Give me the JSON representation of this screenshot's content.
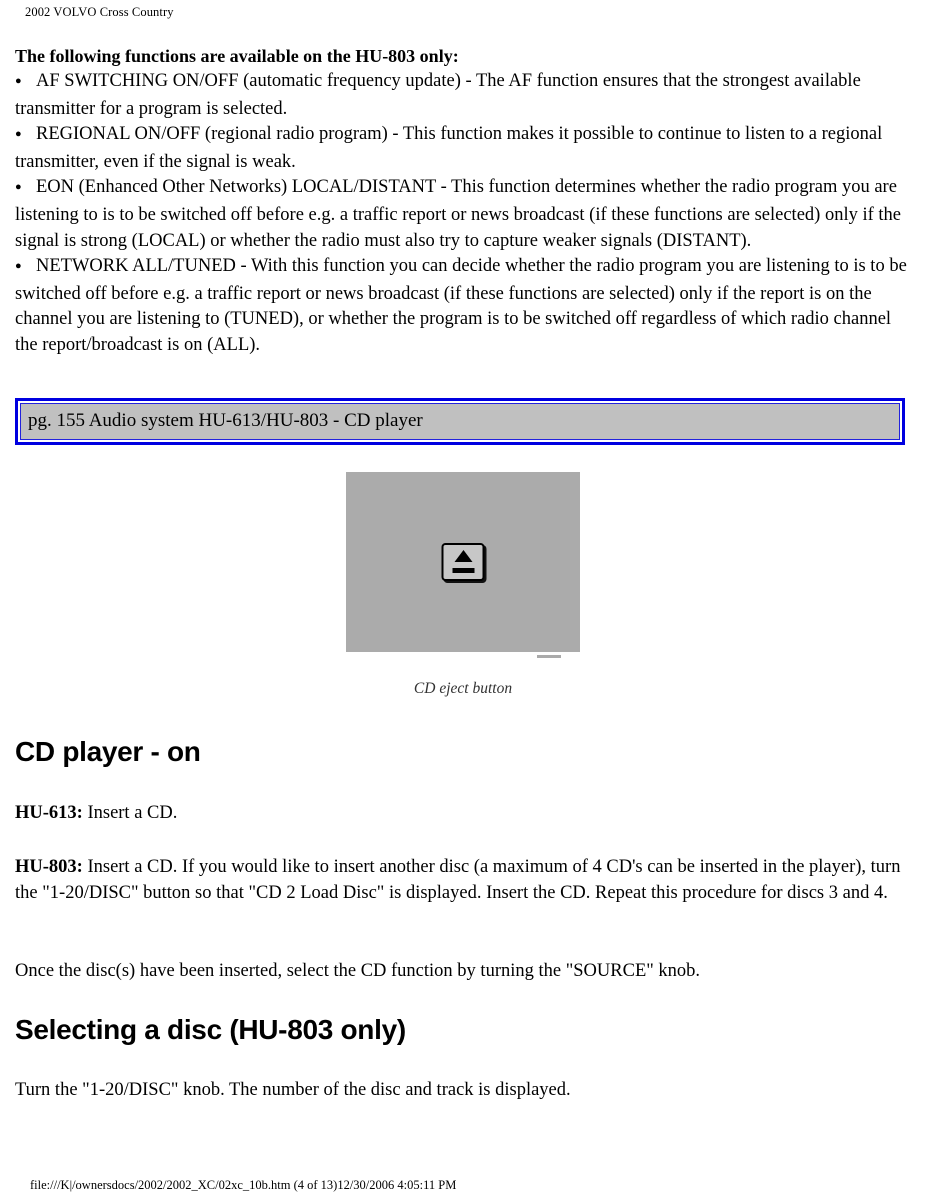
{
  "page": {
    "running_header": "2002 VOLVO Cross Country",
    "footer": "file:///K|/ownersdocs/2002/2002_XC/02xc_10b.htm (4 of 13)12/30/2006 4:05:11 PM"
  },
  "intro": {
    "lead": "The following functions are available on the HU-803 only:",
    "bullets": [
      "AF SWITCHING ON/OFF (automatic frequency update) - The AF function ensures that the strongest available transmitter for a program is selected.",
      "REGIONAL ON/OFF (regional radio program) - This function makes it possible to continue to listen to a regional transmitter, even if the signal is weak.",
      "EON (Enhanced Other Networks) LOCAL/DISTANT - This function determines whether the radio program you are listening to is to be switched off before e.g. a traffic report or news broadcast (if these functions are selected) only if the signal is strong (LOCAL) or whether the radio must also try to capture weaker signals (DISTANT).",
      "NETWORK ALL/TUNED - With this function you can decide whether the radio program you are listening to is to be switched off before e.g. a traffic report or news broadcast (if these functions are selected) only if the report is on the channel you are listening to (TUNED), or whether the program is to be switched off regardless of which radio channel the report/broadcast is on (ALL)."
    ]
  },
  "link_box": {
    "text": "pg. 155 Audio system HU-613/HU-803 - CD player",
    "border_color": "#0000e0",
    "inner_border_color": "#2222dd",
    "fill_color": "#c0c0c0"
  },
  "figure": {
    "caption": "CD eject button",
    "background_color": "#ababab",
    "icon_name": "eject-icon"
  },
  "sections": [
    {
      "heading": "CD player - on",
      "paragraphs": [
        {
          "label": "HU-613:",
          "text": " Insert a CD."
        },
        {
          "label": "HU-803:",
          "text": " Insert a CD. If you would like to insert another disc (a maximum of 4 CD's can be inserted in the player), turn the \"1-20/DISC\" button so that \"CD 2 Load Disc\" is displayed. Insert the CD. Repeat this procedure for discs 3 and 4."
        },
        {
          "label": "",
          "text": "Once the disc(s) have been inserted, select the CD function by turning the \"SOURCE\" knob."
        }
      ]
    },
    {
      "heading": "Selecting a disc (HU-803 only)",
      "paragraphs": [
        {
          "label": "",
          "text": "Turn the \"1-20/DISC\" knob. The number of the disc and track is displayed."
        }
      ]
    }
  ]
}
